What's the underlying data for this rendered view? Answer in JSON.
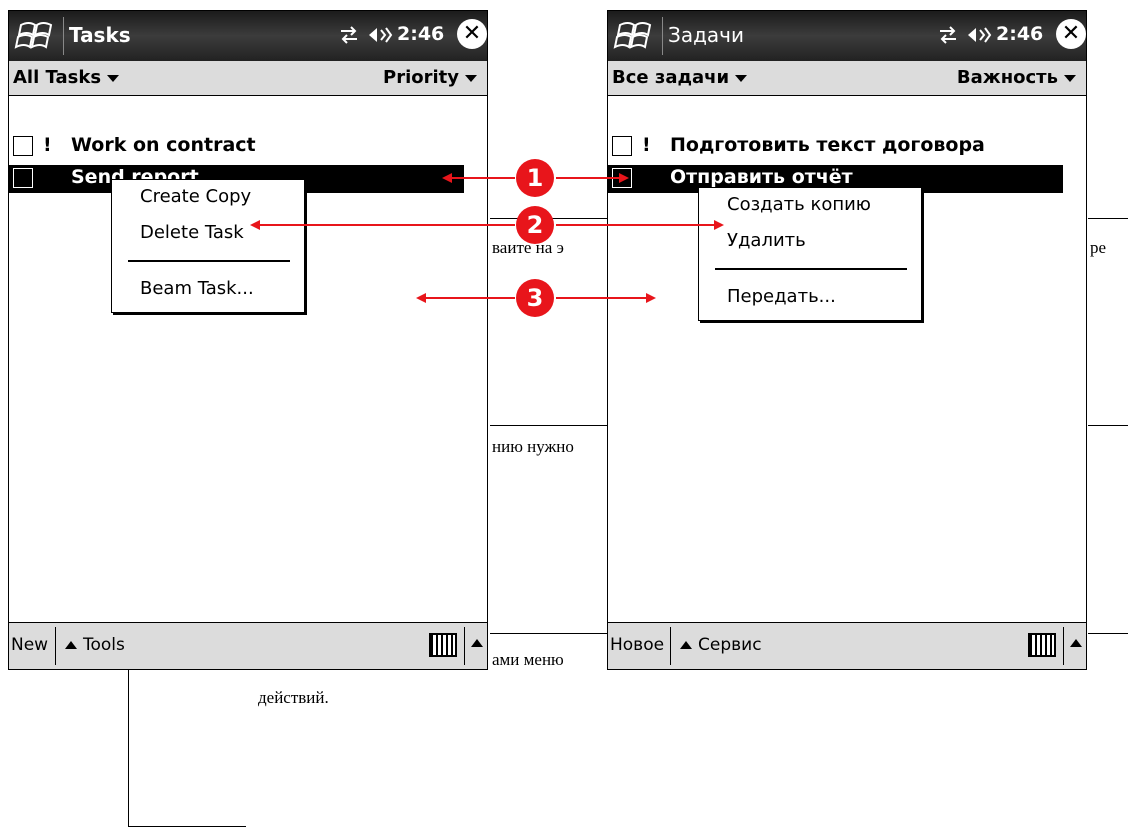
{
  "background_doc": {
    "text_1": "ваите на э",
    "text_2": "ре",
    "text_3": "нию нужно",
    "text_4": "ами меню",
    "text_5": "действий."
  },
  "left_screen": {
    "title": "Tasks",
    "clock": "2:46",
    "close": "✕",
    "filter_left": "All Tasks",
    "filter_right": "Priority",
    "tasks": [
      {
        "priority": "!",
        "label": "Work on contract"
      },
      {
        "priority": "",
        "label": "Send report"
      }
    ],
    "context_menu": {
      "create_copy": "Create Copy",
      "delete": "Delete Task",
      "beam": "Beam Task..."
    },
    "bottom_new": "New",
    "bottom_tools": "Tools"
  },
  "right_screen": {
    "title": "Задачи",
    "clock": "2:46",
    "close": "✕",
    "filter_left": "Все задачи",
    "filter_right": "Важность",
    "tasks": [
      {
        "priority": "!",
        "label": "Подготовить текст договора"
      },
      {
        "priority": "",
        "label": "Отправить отчёт"
      }
    ],
    "context_menu": {
      "create_copy": "Создать копию",
      "delete": "Удалить",
      "beam": "Передать..."
    },
    "bottom_new": "Новое",
    "bottom_tools": "Сервис"
  },
  "callouts": {
    "one": "1",
    "two": "2",
    "three": "3",
    "color": "#e8151b"
  }
}
